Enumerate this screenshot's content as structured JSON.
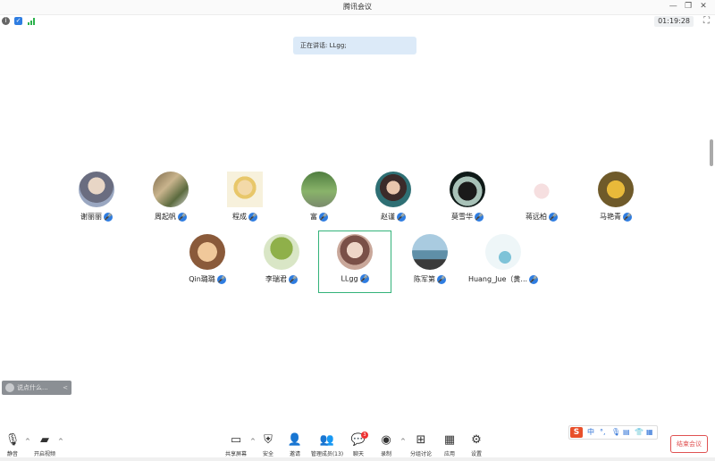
{
  "window": {
    "title": "腾讯会议",
    "controls": {
      "minimize": "—",
      "restore": "❐",
      "close": "✕"
    }
  },
  "status": {
    "info_icon": "info-icon",
    "shield_icon": "shield-icon",
    "signal_icon": "signal-icon",
    "timer": "01:19:28",
    "fullscreen_glyph": "⛶"
  },
  "speaking_banner": "正在讲话: LLgg;",
  "participants": [
    {
      "name": "谢丽丽",
      "mic": "🎤"
    },
    {
      "name": "周起帆",
      "mic": "🎤"
    },
    {
      "name": "程成",
      "mic": "🎤"
    },
    {
      "name": "富",
      "mic": "🎤"
    },
    {
      "name": "赵谨",
      "mic": "🎤"
    },
    {
      "name": "莫雪华",
      "mic": "🎤"
    },
    {
      "name": "蒋远柏",
      "mic": "🎤"
    },
    {
      "name": "马艳青",
      "mic": "🎤"
    },
    {
      "name": "Qin璐璐",
      "mic": "🎤"
    },
    {
      "name": "李瑞君",
      "mic": "🎤"
    },
    {
      "name": "LLgg",
      "mic": "🎤"
    },
    {
      "name": "陈军第",
      "mic": "🎤"
    },
    {
      "name": "Huang_Jue（黄...",
      "mic": "🎤"
    }
  ],
  "chat_input": {
    "placeholder": "说点什么...",
    "collapse": "<"
  },
  "toolbar": {
    "mute": {
      "icon": "🎙",
      "label": "静音"
    },
    "video": {
      "icon": "▰",
      "label": "开启视频"
    },
    "share": {
      "icon": "▭",
      "label": "共享屏幕"
    },
    "security": {
      "icon": "⛨",
      "label": "安全"
    },
    "invite": {
      "icon": "👤",
      "label": "邀请"
    },
    "members": {
      "icon": "👥",
      "label": "管理成员(13)"
    },
    "chat": {
      "icon": "💬",
      "label": "聊天",
      "badge": "3"
    },
    "record": {
      "icon": "◉",
      "label": "录制"
    },
    "breakout": {
      "icon": "⊞",
      "label": "分组讨论"
    },
    "apps": {
      "icon": "▦",
      "label": "应用"
    },
    "settings": {
      "icon": "⚙",
      "label": "设置"
    },
    "caret": "^"
  },
  "ime": {
    "logo": "S",
    "items": [
      "中",
      "°,",
      "🎙",
      "▤",
      "👕",
      "▦"
    ]
  },
  "end_button": "结束会议",
  "colors": {
    "accent": "#2f7de1",
    "speaking_bg": "#dceaf8",
    "active_border": "#33b37a",
    "end": "#e05252"
  }
}
